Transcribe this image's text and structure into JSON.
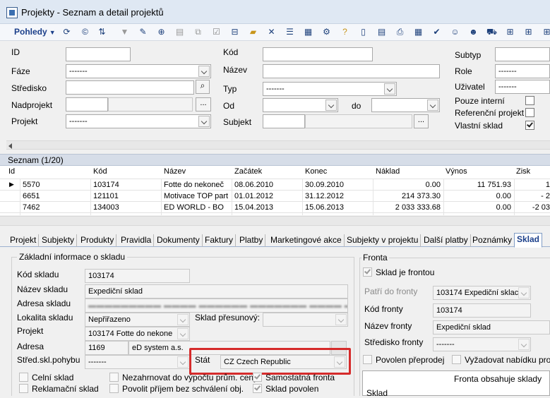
{
  "window": {
    "title": "Projekty - Seznam a detail projektů"
  },
  "toolbar": {
    "views_label": "Pohledy"
  },
  "filter": {
    "id_label": "ID",
    "id_value": "",
    "faze_label": "Fáze",
    "faze_value": "-------",
    "stredisko_label": "Středisko",
    "stredisko_value": "",
    "nadprojekt_label": "Nadprojekt",
    "nadprojekt_value": "",
    "projekt_label": "Projekt",
    "projekt_value": "-------",
    "kod_label": "Kód",
    "kod_value": "",
    "nazev_label": "Název",
    "nazev_value": "",
    "typ_label": "Typ",
    "typ_value": "-------",
    "od_label": "Od",
    "od_value": "",
    "do_label": "do",
    "do_value": "",
    "subjekt_label": "Subjekt",
    "subjekt_value": "",
    "subtyp_label": "Subtyp",
    "subtyp_value": "",
    "role_label": "Role",
    "role_value": "-------",
    "uzivatel_label": "Uživatel",
    "uzivatel_value": "-------",
    "pouze_interni_label": "Pouze interní",
    "referencni_label": "Referenční projekt",
    "vlastni_sklad_label": "Vlastní sklad",
    "ellipsis": "..."
  },
  "list": {
    "header": "Seznam (1/20)",
    "columns": [
      "Id",
      "Kód",
      "Název",
      "Začátek",
      "Konec",
      "Náklad",
      "Výnos",
      "Zisk"
    ],
    "rows": [
      [
        "5570",
        "103174",
        "Fotte do nekoneč",
        "08.06.2010",
        "30.09.2010",
        "0.00",
        "11 751.93",
        "1"
      ],
      [
        "6651",
        "121101",
        "Motivace TOP part",
        "01.01.2012",
        "31.12.2012",
        "214 373.30",
        "0.00",
        "- 2"
      ],
      [
        "7462",
        "134003",
        "ED WORLD - BO",
        "15.04.2013",
        "15.06.2013",
        "2 033 333.68",
        "0.00",
        "-2 03"
      ]
    ]
  },
  "tabs": [
    "Projekt",
    "Subjekty",
    "Produkty",
    "Pravidla",
    "Dokumenty",
    "Faktury",
    "Platby",
    "Marketingové akce",
    "Subjekty v projektu",
    "Další platby",
    "Poznámky",
    "Sklad"
  ],
  "sklad": {
    "group_title": "Základní informace o skladu",
    "kod_label": "Kód skladu",
    "kod_value": "103174",
    "nazev_label": "Název skladu",
    "nazev_value": "Expediční sklad",
    "adresa_label": "Adresa skladu",
    "lokalita_label": "Lokalita skladu",
    "lokalita_value": "Nepřiřazeno",
    "presunovy_label": "Sklad přesunový:",
    "projekt_label": "Projekt",
    "projekt_value": "103174 Fotte do nekone",
    "adresa2_label": "Adresa",
    "adresa2_id": "1169",
    "adresa2_name": "eD system a.s.",
    "stred_label": "Střed.skl.pohybu",
    "stred_value": "-------",
    "stat_label": "Stát",
    "stat_value": "CZ  Czech Republic",
    "celni_label": "Celní sklad",
    "nezahrnovat_label": "Nezahrnovat do výpočtu prům. ceny",
    "samostatna_label": "Samostatná fronta",
    "reklamacni_label": "Reklamační sklad",
    "povolit_label": "Povolit příjem bez schválení obj.",
    "povolen_label": "Sklad povolen"
  },
  "fronta": {
    "group_title": "Fronta",
    "je_frontou_label": "Sklad je frontou",
    "patri_label": "Patří do fronty",
    "patri_value": "103174 Expediční sklac",
    "kod_label": "Kód fronty",
    "kod_value": "103174",
    "nazev_label": "Název fronty",
    "nazev_value": "Expediční sklad",
    "stredisko_label": "Středisko fronty",
    "stredisko_value": "-------",
    "povolen_prevod_label": "Povolen přeprodej",
    "vyzadovat_label": "Vyžadovat nabídku prod",
    "obsahuje_label": "Fronta obsahuje sklady",
    "list_col": "Sklad"
  }
}
